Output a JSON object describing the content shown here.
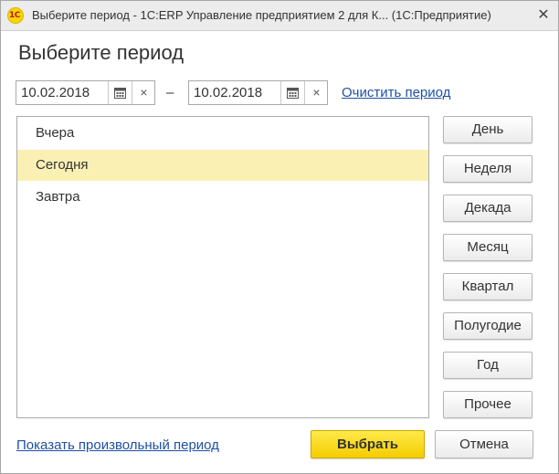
{
  "window": {
    "title": "Выберите период - 1С:ERP Управление предприятием 2 для К...  (1С:Предприятие)",
    "logo_text": "1С",
    "close_glyph": "✕"
  },
  "heading": "Выберите период",
  "period": {
    "start": {
      "value": "10.02.2018",
      "calendar_icon": "calendar-icon",
      "clear_glyph": "×"
    },
    "separator": "–",
    "end": {
      "value": "10.02.2018",
      "calendar_icon": "calendar-icon",
      "clear_glyph": "×"
    },
    "clear_link": "Очистить период"
  },
  "list": {
    "items": [
      {
        "label": "Вчера",
        "selected": false
      },
      {
        "label": "Сегодня",
        "selected": true
      },
      {
        "label": "Завтра",
        "selected": false
      }
    ],
    "selected_color": "#faf0b4"
  },
  "period_buttons": [
    "День",
    "Неделя",
    "Декада",
    "Месяц",
    "Квартал",
    "Полугодие",
    "Год",
    "Прочее"
  ],
  "footer": {
    "custom_period_link": "Показать произвольный период",
    "select_button": "Выбрать",
    "cancel_button": "Отмена"
  },
  "colors": {
    "accent_yellow": "#f4cd00",
    "link_blue": "#1e50a2"
  }
}
